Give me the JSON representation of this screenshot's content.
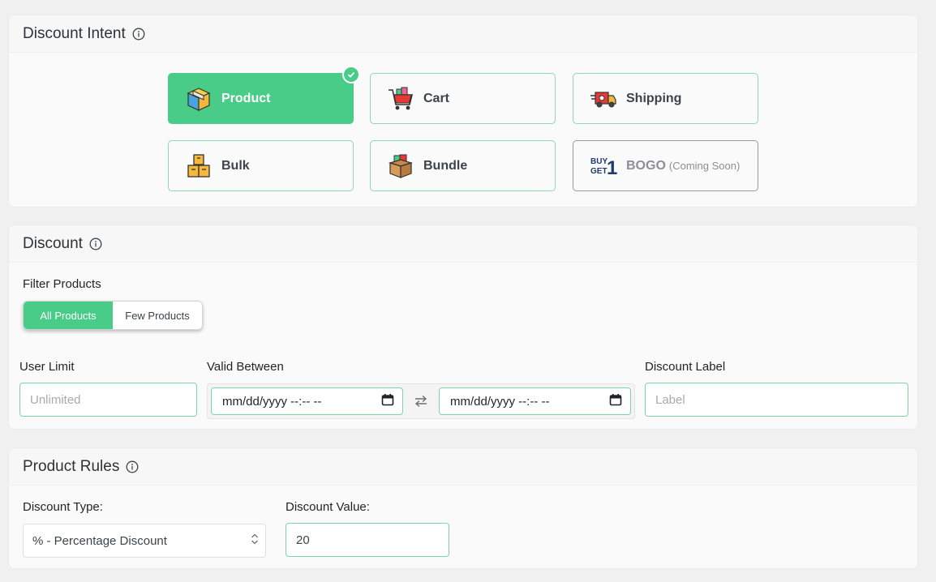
{
  "intent": {
    "title": "Discount Intent",
    "tiles": [
      {
        "label": "Product",
        "icon": "product-box-icon",
        "active": true
      },
      {
        "label": "Cart",
        "icon": "shopping-cart-icon"
      },
      {
        "label": "Shipping",
        "icon": "delivery-truck-icon"
      },
      {
        "label": "Bulk",
        "icon": "stacked-boxes-icon"
      },
      {
        "label": "Bundle",
        "icon": "bundle-box-icon"
      },
      {
        "label": "BOGO",
        "suffix": "(Coming Soon)",
        "icon": "buy-get-one-icon",
        "disabled": true
      }
    ]
  },
  "discount": {
    "title": "Discount",
    "filter_label": "Filter Products",
    "filter_options": [
      "All Products",
      "Few Products"
    ],
    "filter_selected": "All Products",
    "user_limit_label": "User Limit",
    "user_limit_placeholder": "Unlimited",
    "valid_between_label": "Valid Between",
    "date_from": "mm/dd/yyyy --:-- --",
    "date_to": "mm/dd/yyyy --:-- --",
    "discount_label_label": "Discount Label",
    "discount_label_placeholder": "Label"
  },
  "rules": {
    "title": "Product Rules",
    "type_label": "Discount Type:",
    "type_value": "% - Percentage Discount",
    "value_label": "Discount Value:",
    "value": "20"
  },
  "colors": {
    "accent": "#48cc88",
    "border_accent": "#8fd9b0"
  }
}
